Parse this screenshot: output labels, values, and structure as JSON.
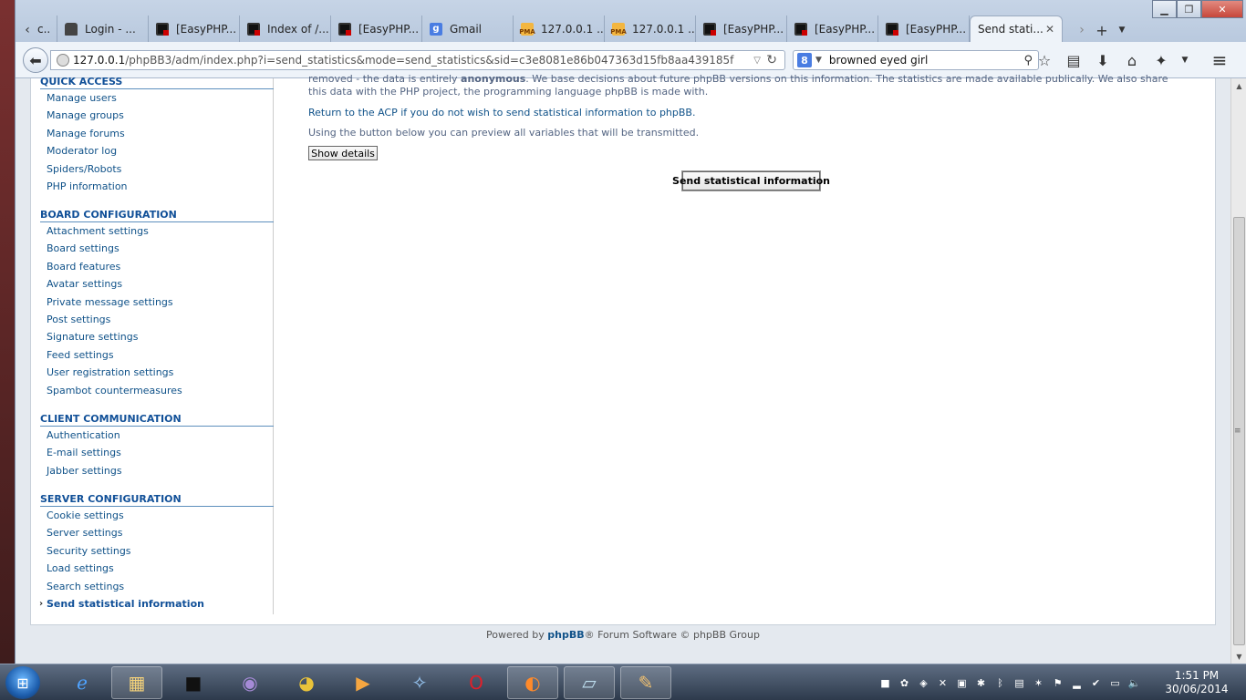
{
  "browser": {
    "tabs": [
      {
        "label": "",
        "icon": "page-icon",
        "type": "lock"
      },
      {
        "label": "Login - ...",
        "icon": "page-icon",
        "type": "lock"
      },
      {
        "label": "[EasyPHP...",
        "icon": "easyphp-icon",
        "type": "ep"
      },
      {
        "label": "Index of /...",
        "icon": "easyphp-icon",
        "type": "ep"
      },
      {
        "label": "[EasyPHP...",
        "icon": "easyphp-icon",
        "type": "ep"
      },
      {
        "label": "Gmail",
        "icon": "google-icon",
        "type": "g"
      },
      {
        "label": "127.0.0.1 ...",
        "icon": "phpmyadmin-icon",
        "type": "pma"
      },
      {
        "label": "127.0.0.1 ...",
        "icon": "phpmyadmin-icon",
        "type": "pma"
      },
      {
        "label": "[EasyPHP...",
        "icon": "easyphp-icon",
        "type": "ep"
      },
      {
        "label": "[EasyPHP...",
        "icon": "easyphp-icon",
        "type": "ep"
      },
      {
        "label": "[EasyPHP...",
        "icon": "easyphp-icon",
        "type": "ep"
      }
    ],
    "first_tab_label": "c..",
    "active_tab": "Send stati...",
    "url_host": "127.0.0.1",
    "url_path": "/phpBB3/adm/index.php?i=send_statistics&mode=send_statistics&sid=c3e8081e86b047363d15fb8aa439185f",
    "search_value": "browned eyed girl",
    "search_engine_letter": "8"
  },
  "menu": {
    "sections": [
      {
        "title": "QUICK ACCESS",
        "items": [
          "Manage users",
          "Manage groups",
          "Manage forums",
          "Moderator log",
          "Spiders/Robots",
          "PHP information"
        ]
      },
      {
        "title": "BOARD CONFIGURATION",
        "items": [
          "Attachment settings",
          "Board settings",
          "Board features",
          "Avatar settings",
          "Private message settings",
          "Post settings",
          "Signature settings",
          "Feed settings",
          "User registration settings",
          "Spambot countermeasures"
        ]
      },
      {
        "title": "CLIENT COMMUNICATION",
        "items": [
          "Authentication",
          "E-mail settings",
          "Jabber settings"
        ]
      },
      {
        "title": "SERVER CONFIGURATION",
        "items": [
          "Cookie settings",
          "Server settings",
          "Security settings",
          "Load settings",
          "Search settings",
          "Send statistical information"
        ]
      }
    ]
  },
  "main": {
    "intro_line1_a": "removed - the data is entirely ",
    "intro_bold": "anonymous",
    "intro_line1_b": ". We base decisions about future phpBB versions on this information. The statistics are made available publically. We also share",
    "intro_line2": "this data with the PHP project, the programming language phpBB is made with.",
    "return_text": "Return to the ACP if you do not wish to send statistical information to phpBB.",
    "preview_text": "Using the button below you can preview all variables that will be transmitted.",
    "show_details": "Show details",
    "send_button": "Send statistical information"
  },
  "footer": {
    "prefix": "Powered by ",
    "brand": "phpBB",
    "suffix": "® Forum Software © phpBB Group"
  },
  "taskbar": {
    "time": "1:51 PM",
    "date": "30/06/2014"
  }
}
